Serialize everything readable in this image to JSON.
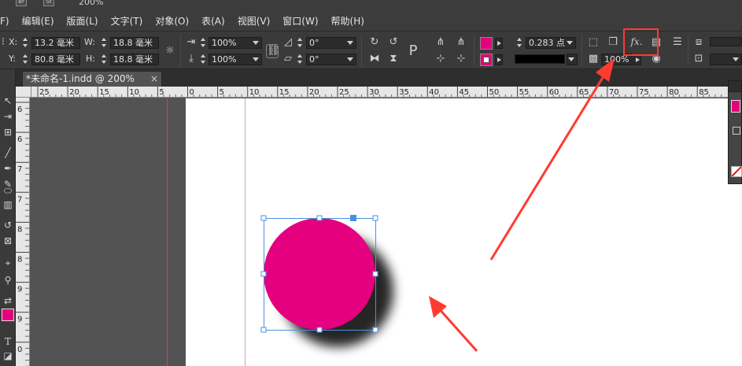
{
  "topbar": {
    "btn_br": "Br",
    "btn_st": "St",
    "zoom": "200%"
  },
  "menu": {
    "items": [
      "F)",
      "编辑(E)",
      "版面(L)",
      "文字(T)",
      "对象(O)",
      "表(A)",
      "视图(V)",
      "窗口(W)",
      "帮助(H)"
    ]
  },
  "control": {
    "x_label": "X:",
    "x_value": "13.2 毫米",
    "y_label": "Y:",
    "y_value": "80.8 毫米",
    "w_label": "W:",
    "w_value": "18.8 毫米",
    "h_label": "H:",
    "h_value": "18.8 毫米",
    "scale_x": "100%",
    "scale_y": "100%",
    "rotate": "0°",
    "shear": "0°",
    "stroke_weight": "0.283 点",
    "opacity": "100%",
    "fx_label": "fx."
  },
  "document": {
    "tab_title": "*未命名-1.indd @ 200%",
    "tab_close": "×"
  },
  "ruler": {
    "h_labels": [
      "25",
      "20",
      "15",
      "10",
      "5",
      "0",
      "5",
      "10",
      "15",
      "20",
      "25",
      "30",
      "35",
      "40",
      "45",
      "50",
      "55",
      "60",
      "65",
      "70",
      "75",
      "80",
      "85"
    ],
    "v_labels": [
      "6",
      "6",
      "7",
      "7",
      "8",
      "8",
      "9",
      "9",
      "0",
      "0"
    ]
  },
  "colors": {
    "fill": "#E4007F",
    "selection": "#4a90e2",
    "annotation": "#ff3b30",
    "guide": "#d23a6a"
  },
  "tools": {
    "icons": [
      "selection-icon",
      "direct-select-icon",
      "gap-tool-icon",
      "line-tool-icon",
      "pen-tool-icon",
      "pencil-tool-icon",
      "ellipse-frame-icon",
      "rectangle-tool-icon",
      "rotate-tool-icon",
      "free-transform-icon",
      "eyedropper-icon",
      "zoom-icon",
      "swap-fill-stroke-icon",
      "fill-swatch-icon",
      "type-tool-icon",
      "apply-none-icon"
    ]
  }
}
